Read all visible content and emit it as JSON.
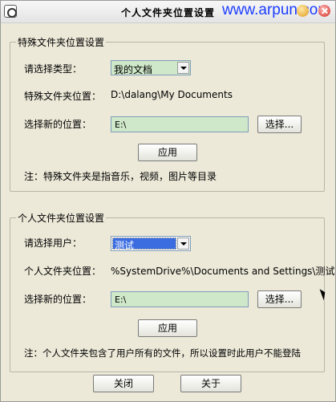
{
  "window": {
    "title": "个人文件夹位置设置",
    "watermark": "www.arpun.com"
  },
  "special": {
    "legend": "特殊文件夹位置设置",
    "type_label": "请选择类型：",
    "type_selected": "我的文档",
    "location_label": "特殊文件夹位置：",
    "location_value": "D:\\dalang\\My Documents",
    "new_location_label": "选择新的位置：",
    "new_location_value": "E:\\",
    "browse_button": "选择...",
    "apply_button": "应用",
    "note": "注：特殊文件夹是指音乐，视频，图片等目录"
  },
  "personal": {
    "legend": "个人文件夹位置设置",
    "user_label": "请选择用户：",
    "user_selected": "测试",
    "location_label": "个人文件夹位置：",
    "location_value": "%SystemDrive%\\Documents and Settings\\测试",
    "new_location_label": "选择新的位置：",
    "new_location_value": "E:\\",
    "browse_button": "选择...",
    "apply_button": "应用",
    "note": "注：个人文件夹包含了用户所有的文件，所以设置时此用户不能登陆"
  },
  "footer": {
    "close_button": "关闭",
    "about_button": "关于"
  },
  "colors": {
    "background": "#ece9d8",
    "field_green": "#cfe8c9",
    "selection_blue": "#3b6de0",
    "watermark_blue": "#1a3cff"
  }
}
